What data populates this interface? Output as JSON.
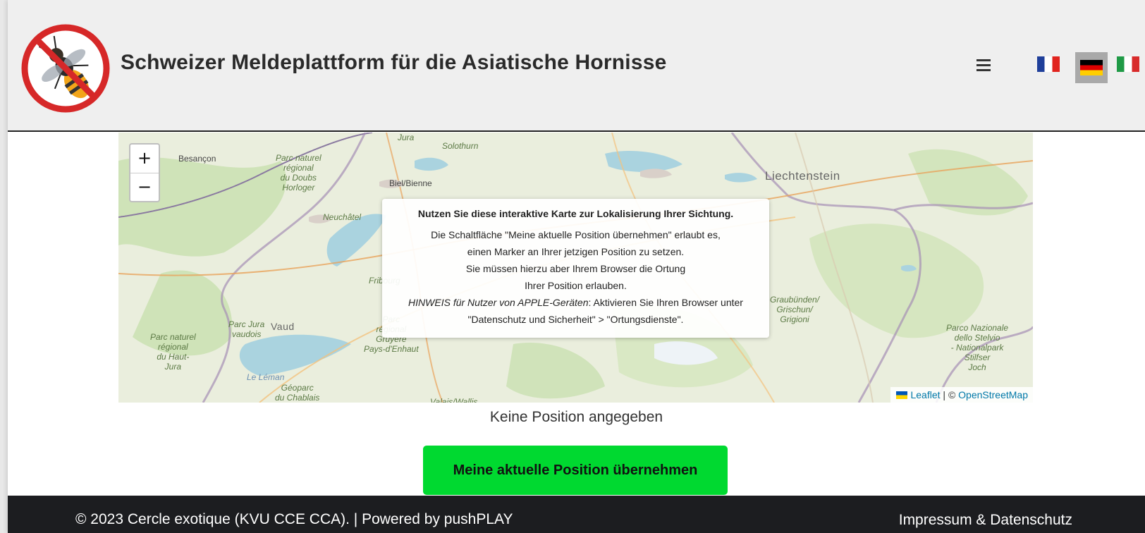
{
  "header": {
    "title": "Schweizer Meldeplattform für die Asiatische Hornisse",
    "logo": "no-hornet-logo",
    "menu_icon": "hamburger-menu-icon",
    "languages": [
      {
        "code": "fr",
        "icon": "flag-france-icon"
      },
      {
        "code": "de",
        "icon": "flag-germany-icon",
        "active": true
      },
      {
        "code": "it",
        "icon": "flag-italy-icon"
      }
    ]
  },
  "map": {
    "zoom_in": "+",
    "zoom_out": "−",
    "labels": {
      "besancon": "Besançon",
      "jura": "Jura",
      "solothurn": "Solothurn",
      "biel": "Biel/Bienne",
      "doubs": "Parc naturel\nrégional\ndu Doubs\nHorloger",
      "neuchatel": "Neuchâtel",
      "liechtenstein": "Liechtenstein",
      "fribourg": "Fribourg",
      "parc_jura_vaudois": "Parc Jura\nvaudois",
      "vaud": "Vaud",
      "haut_jura": "Parc naturel\nrégional\ndu Haut-\nJura",
      "gruyere": "Parc\nrégional\nGruyère\nPays-d'Enhaut",
      "leman": "Le Léman",
      "chablais": "Géoparc\ndu Chablais",
      "valais": "Valais/Wallis",
      "graubuenden": "Graubünden/\nGrischun/\nGrigioni",
      "stelvio": "Parco Nazionale\ndello Stelvio\n- Nationalpark\nStilfser\nJoch"
    },
    "info": {
      "title": "Nutzen Sie diese interaktive Karte zur Lokalisierung Ihrer Sichtung.",
      "line1": "Die Schaltfläche \"Meine aktuelle Position übernehmen\" erlaubt es,",
      "line2": "einen Marker an Ihrer jetzigen Position zu setzen.",
      "line3": "Sie müssen hierzu aber Ihrem Browser die Ortung",
      "line4": "Ihrer Position erlauben.",
      "hint_label": "HINWEIS für Nutzer von APPLE-Geräten",
      "hint_text": ": Aktivieren Sie Ihren Browser unter",
      "line6": "\"Datenschutz und Sicherheit\" > \"Ortungsdienste\"."
    },
    "attribution": {
      "leaflet": "Leaflet",
      "separator": " | © ",
      "osm": "OpenStreetMap"
    }
  },
  "status": "Keine Position angegeben",
  "locate_button": "Meine aktuelle Position übernehmen",
  "footer": {
    "copyright": "© 2023 Cercle exotique (KVU CCE CCA). | Powered by pushPLAY",
    "legal": "Impressum & Datenschutz"
  }
}
